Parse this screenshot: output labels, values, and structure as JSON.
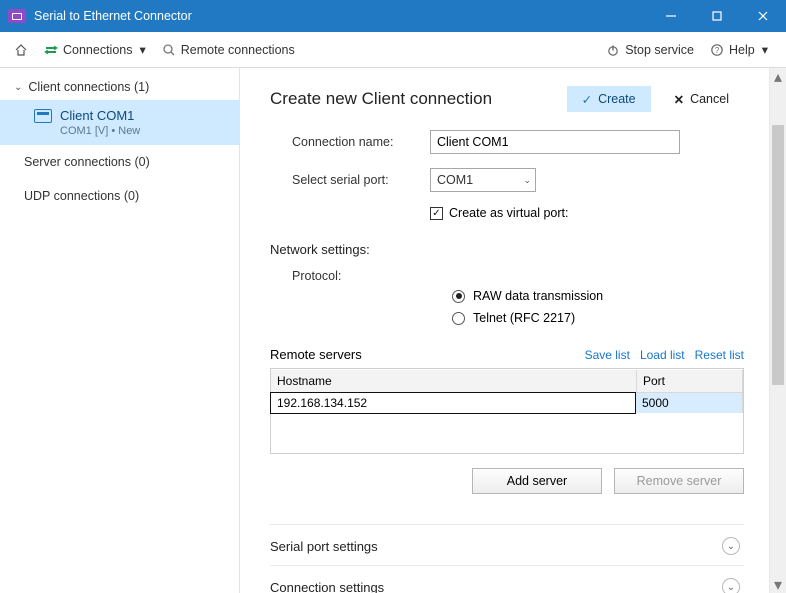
{
  "titlebar": {
    "title": "Serial to Ethernet Connector"
  },
  "toolbar": {
    "home_label": "",
    "connections_label": "Connections",
    "remote_label": "Remote connections",
    "stop_label": "Stop service",
    "help_label": "Help"
  },
  "sidebar": {
    "client_group_label": "Client connections (1)",
    "client_item": {
      "name": "Client COM1",
      "sub": "COM1 [V] • New"
    },
    "server_group_label": "Server connections (0)",
    "udp_group_label": "UDP connections (0)"
  },
  "page": {
    "title": "Create new Client connection",
    "create_label": "Create",
    "cancel_label": "Cancel",
    "conn_name_label": "Connection name:",
    "conn_name_value": "Client COM1",
    "port_label": "Select serial port:",
    "port_value": "COM1",
    "create_virtual_label": "Create as virtual port:",
    "net_settings_label": "Network settings:",
    "protocol_label": "Protocol:",
    "protocol_raw": "RAW data transmission",
    "protocol_telnet": "Telnet (RFC 2217)",
    "remote_servers_label": "Remote servers",
    "save_list": "Save list",
    "load_list": "Load list",
    "reset_list": "Reset list",
    "col_hostname": "Hostname",
    "col_port": "Port",
    "row0_host": "192.168.134.152",
    "row0_port": "5000",
    "add_server": "Add server",
    "remove_server": "Remove server",
    "serial_settings_label": "Serial port settings",
    "conn_settings_label": "Connection settings"
  }
}
